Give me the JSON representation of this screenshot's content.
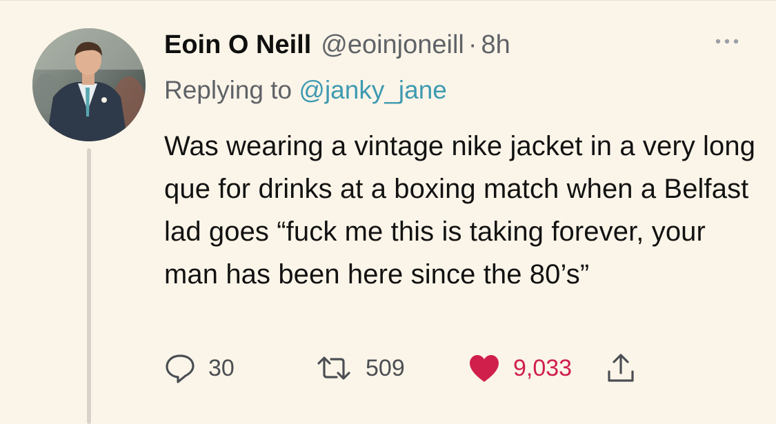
{
  "tweet": {
    "author_name": "Eoin O Neill",
    "handle": "@eoinjoneill",
    "separator": "·",
    "time": "8h",
    "replying_prefix": "Replying to ",
    "replying_to": "@janky_jane",
    "text": "Was wearing a vintage nike jacket in a very long que for drinks at a boxing match when a Belfast lad goes “fuck me this is taking forever, your man has been here since the 80’s”",
    "liked": true
  },
  "actions": {
    "reply_count": "30",
    "retweet_count": "509",
    "like_count": "9,033"
  },
  "icons": {
    "reply": "reply-icon",
    "retweet": "retweet-icon",
    "like": "heart-icon",
    "share": "share-icon",
    "more": "more-icon"
  },
  "colors": {
    "background": "#fbf4e8",
    "mention": "#3d9ab0",
    "like": "#d01f4b",
    "muted": "#5f6368"
  }
}
